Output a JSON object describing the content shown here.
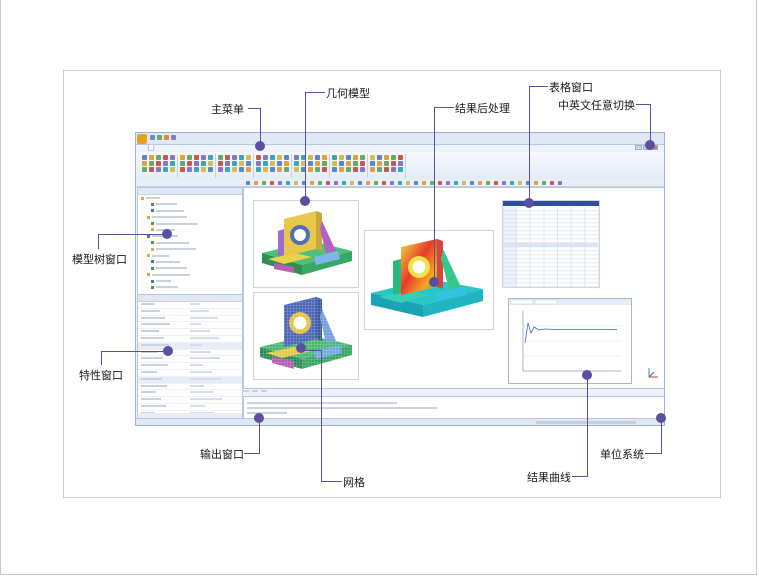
{
  "callouts": {
    "main_menu": "主菜单",
    "geometry_model": "几何模型",
    "post_processing": "结果后处理",
    "table_window": "表格窗口",
    "language_switch": "中英文任意切换",
    "model_tree": "模型树窗口",
    "property_window": "特性窗口",
    "output_window": "输出窗口",
    "mesh": "网格",
    "result_curve": "结果曲线",
    "unit_system": "单位系统"
  },
  "colors": {
    "callout_accent": "#5a4fa0",
    "window_border": "#9bb3cf",
    "ribbon_bg": "#e3ecf7"
  },
  "icons": [
    "app-logo-icon",
    "quick-access-icon",
    "window-control-icon",
    "ribbon-tool-icon",
    "tree-node-icon"
  ]
}
